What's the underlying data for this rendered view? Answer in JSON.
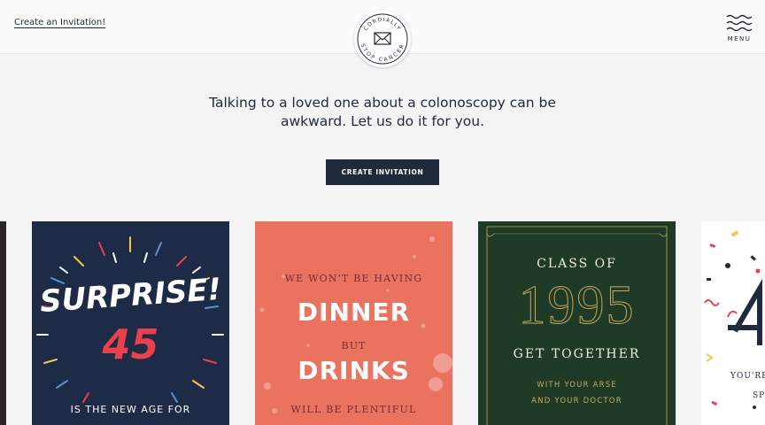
{
  "header": {
    "create_link": "Create an Invitation!",
    "logo": {
      "text_top": "CORDIALLY",
      "text_bottom": "STOP CANCER",
      "icon": "envelope-icon"
    },
    "menu": {
      "label": "MENU",
      "icon": "wavy-menu-icon"
    }
  },
  "hero": {
    "headline": "Talking to a loved one about a colonoscopy can be awkward. Let us do it for you.",
    "cta_label": "CREATE INVITATION"
  },
  "cards": [
    {
      "id": "surprise",
      "bg": "#1e2b47",
      "title": "SURPRISE!",
      "number": "45",
      "subtitle": "IS THE NEW AGE FOR"
    },
    {
      "id": "dinner",
      "bg": "#e9735e",
      "line1": "WE WON'T BE HAVING",
      "line2": "DINNER",
      "line3": "BUT",
      "line4": "DRINKS",
      "line5": "WILL BE PLENTIFUL"
    },
    {
      "id": "class",
      "bg": "#1f3a26",
      "line1": "CLASS OF",
      "year": "1995",
      "line2": "GET TOGETHER",
      "line3": "WITH YOUR ARSE",
      "line4": "AND YOUR DOCTOR"
    },
    {
      "id": "confetti",
      "bg": "#ffffff",
      "line1": "YOU'RE",
      "line2": "SP"
    }
  ],
  "colors": {
    "navy": "#1f2a3c",
    "accent_red": "#e8414c",
    "gold": "#c9a85a"
  }
}
